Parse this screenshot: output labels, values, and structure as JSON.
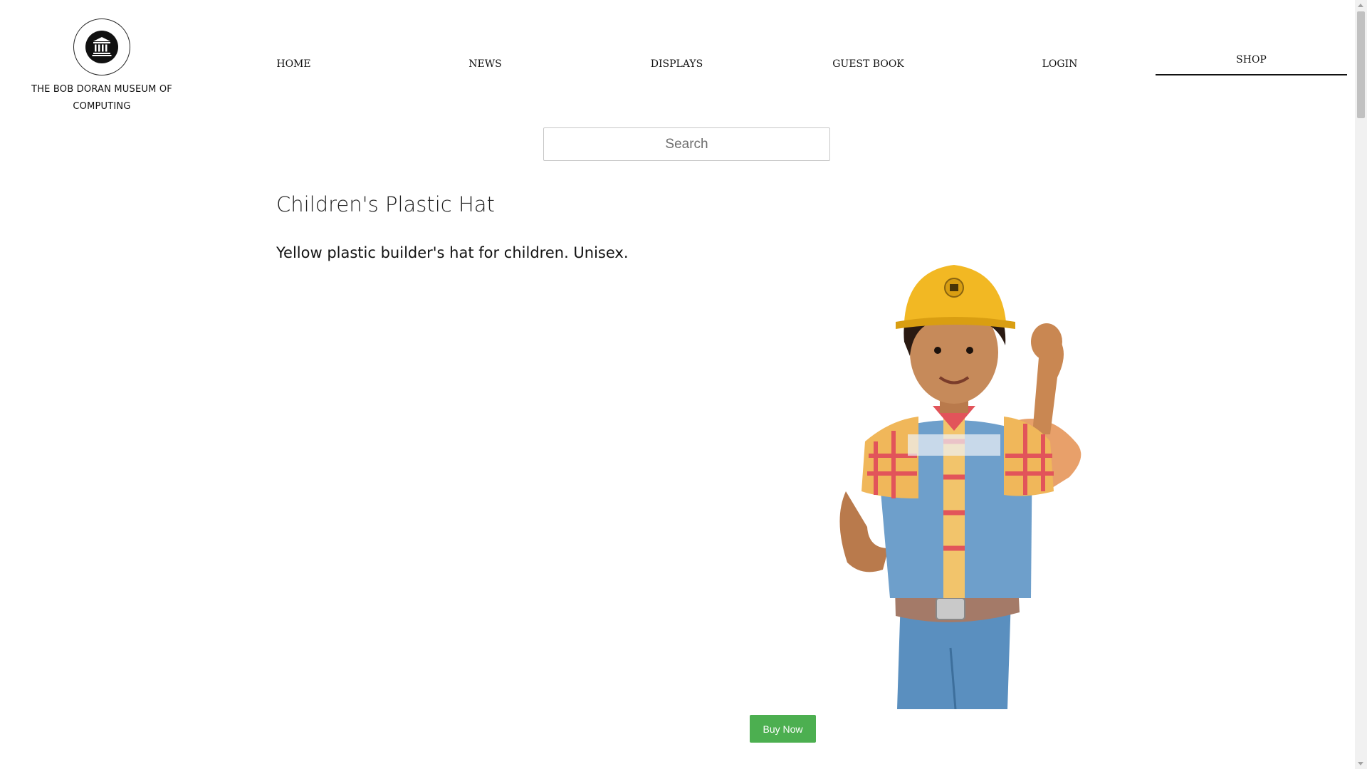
{
  "site": {
    "name": "THE BOB DORAN MUSEUM OF COMPUTING",
    "logo_icon": "museum-building-icon"
  },
  "nav": {
    "items": [
      {
        "label": "HOME"
      },
      {
        "label": "NEWS"
      },
      {
        "label": "DISPLAYS"
      },
      {
        "label": "GUEST BOOK"
      },
      {
        "label": "LOGIN"
      },
      {
        "label": "SHOP"
      }
    ],
    "active": "SHOP"
  },
  "search": {
    "placeholder": "Search",
    "value": ""
  },
  "product": {
    "title": "Children's Plastic Hat",
    "description": "Yellow plastic builder's hat for children. Unisex.",
    "image": "child-wearing-yellow-builder-hat",
    "buy_label": "Buy Now"
  },
  "colors": {
    "buy_button": "#4caf50",
    "hat": "#f2b823"
  }
}
